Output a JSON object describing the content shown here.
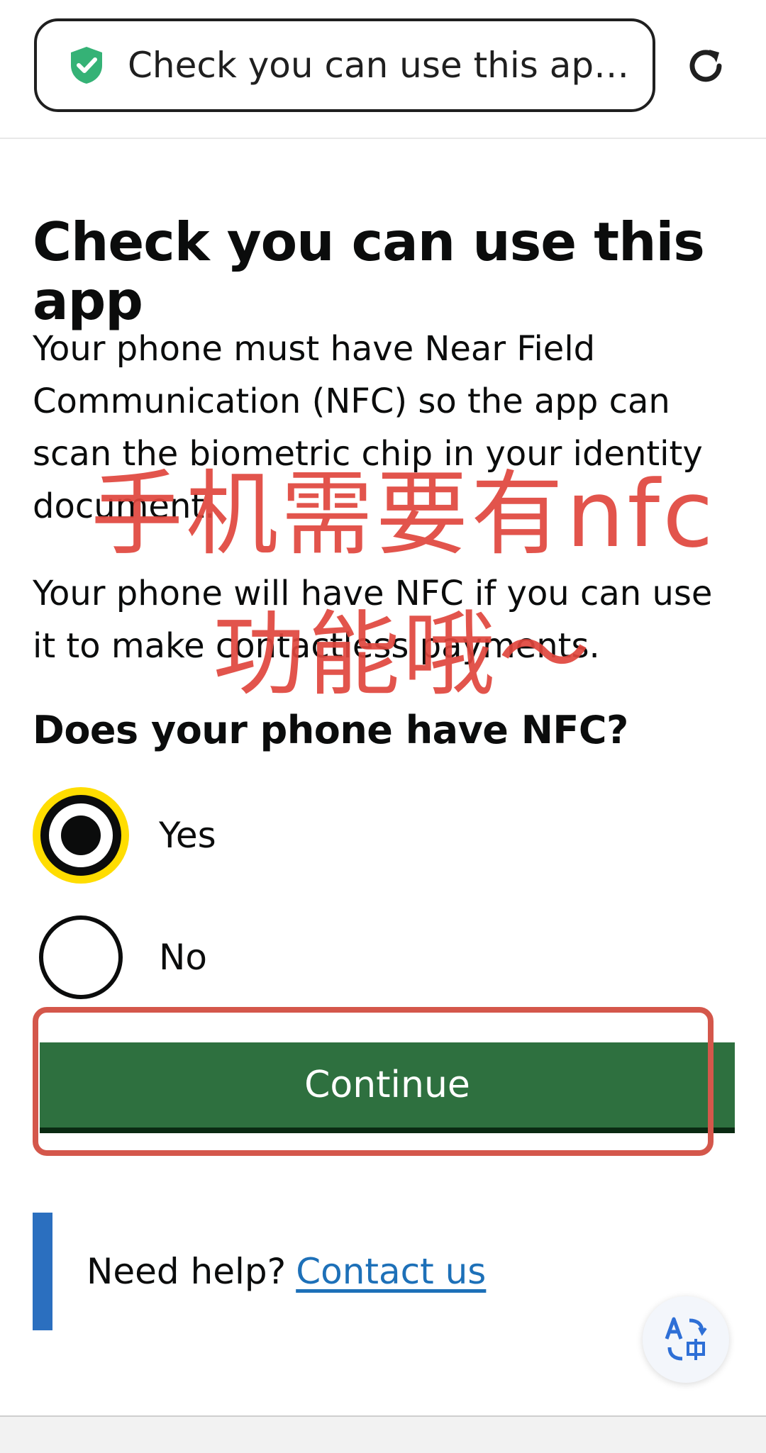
{
  "browser": {
    "url_title": "Check you can use this app…",
    "colors": {
      "shield": "#35b276",
      "border": "#1f1f1f"
    },
    "icons": [
      "shield-check-icon",
      "reload-icon"
    ]
  },
  "content": {
    "heading": "Check you can use this app",
    "paragraph1": "Your phone must have Near Field Communication (NFC) so the app can scan the biometric chip in your identity document.",
    "paragraph2": "Your phone will have NFC if you can use it to make contactless payments.",
    "question": "Does your phone have NFC?",
    "options": [
      {
        "label": "Yes",
        "selected": true,
        "focused": true
      },
      {
        "label": "No",
        "selected": false
      }
    ],
    "continue_label": "Continue",
    "help_prefix": "Need help?",
    "help_link": "Contact us"
  },
  "annotation": {
    "line1": "手机需要有nfc",
    "line2": "功能哦～",
    "color": "#e0463d"
  },
  "colors": {
    "button_green": "#2e703f",
    "link_blue": "#1d70b8",
    "focus_yellow": "#ffdd00",
    "help_bar": "#2b6fbf"
  },
  "fab": {
    "icon": "translate-icon"
  }
}
